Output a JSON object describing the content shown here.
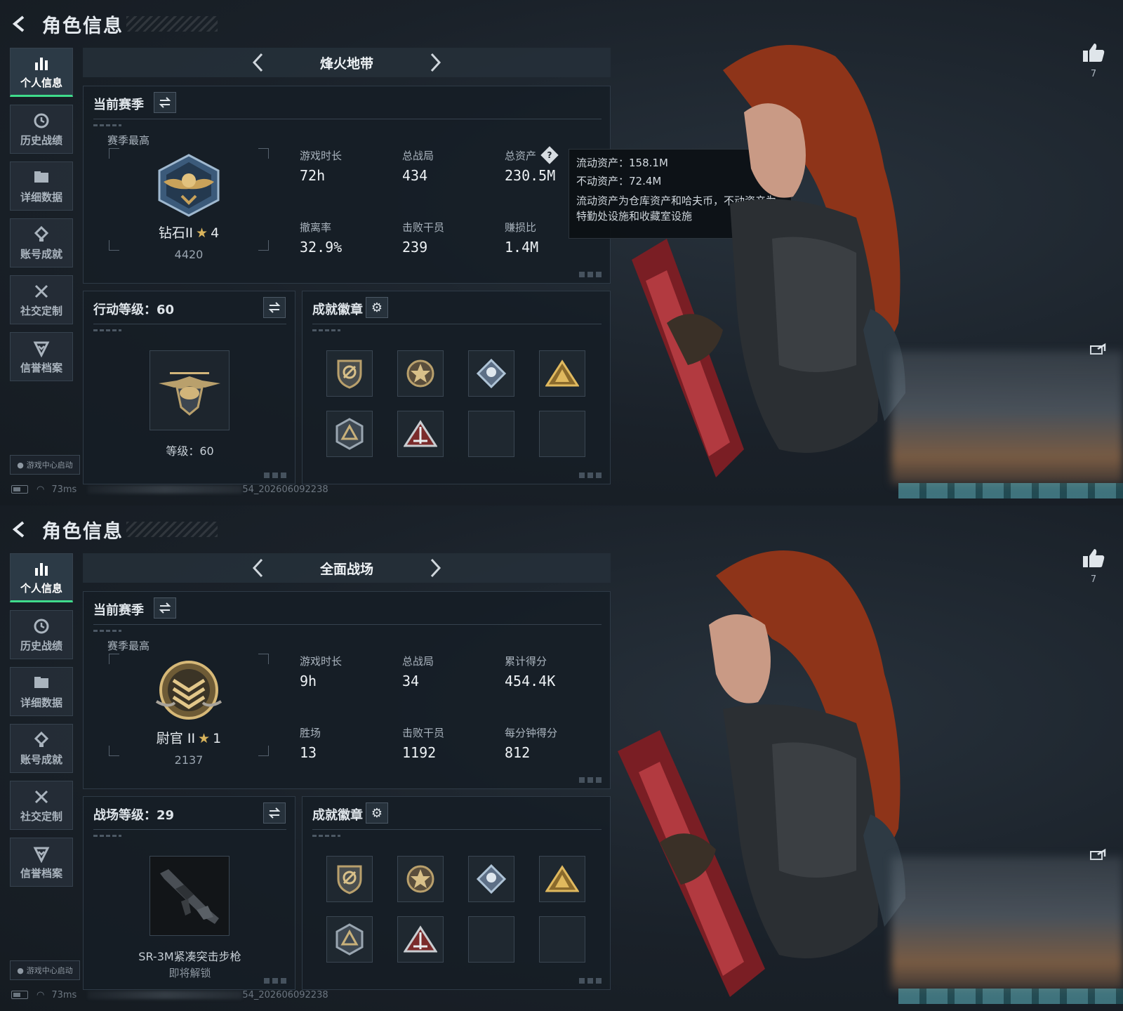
{
  "screens": [
    {
      "header": {
        "title": "角色信息"
      },
      "nav": {
        "items": [
          {
            "label": "个人信息",
            "icon": "bar-chart-icon",
            "active": true
          },
          {
            "label": "历史战绩",
            "icon": "clock-history-icon"
          },
          {
            "label": "详细数据",
            "icon": "folder-icon"
          },
          {
            "label": "账号成就",
            "icon": "achievement-icon"
          },
          {
            "label": "社交定制",
            "icon": "tools-icon"
          },
          {
            "label": "信誉档案",
            "icon": "shield-check-icon"
          }
        ]
      },
      "launcher": "游戏中心启动",
      "status": {
        "ping": "73ms",
        "build": "54_202606092238"
      },
      "mode": {
        "name": "烽火地带"
      },
      "season": {
        "title": "当前赛季",
        "best_label": "赛季最高",
        "rank_name": "钻石II",
        "rank_stars": "4",
        "rank_score": "4420",
        "stats": [
          {
            "label": "游戏时长",
            "value": "72h"
          },
          {
            "label": "总战局",
            "value": "434"
          },
          {
            "label": "总资产",
            "value": "230.5M",
            "help": true
          },
          {
            "label": "撤离率",
            "value": "32.9%"
          },
          {
            "label": "击败干员",
            "value": "239"
          },
          {
            "label": "赚损比",
            "value": "1.4M"
          }
        ]
      },
      "tooltip": {
        "line1": "流动资产：158.1M",
        "line2": "不动资产：72.4M",
        "desc": "流动资产为仓库资产和哈夫币，不动资产为特勤处设施和收藏室设施"
      },
      "level": {
        "title": "行动等级：60",
        "caption": "等级：60",
        "sub": ""
      },
      "badges": {
        "title": "成就徽章",
        "items": [
          "shield-badge",
          "star-badge",
          "diamond-badge",
          "mountain-badge",
          "triangle-shield-badge",
          "pyramid-badge",
          "empty",
          "empty"
        ]
      },
      "like": {
        "count": "7"
      },
      "colors": {
        "accent": "#3fdc8b",
        "star": "#d9b45c"
      }
    },
    {
      "header": {
        "title": "角色信息"
      },
      "nav": {
        "items": [
          {
            "label": "个人信息",
            "icon": "bar-chart-icon",
            "active": true
          },
          {
            "label": "历史战绩",
            "icon": "clock-history-icon"
          },
          {
            "label": "详细数据",
            "icon": "folder-icon"
          },
          {
            "label": "账号成就",
            "icon": "achievement-icon"
          },
          {
            "label": "社交定制",
            "icon": "tools-icon"
          },
          {
            "label": "信誉档案",
            "icon": "shield-check-icon"
          }
        ]
      },
      "launcher": "游戏中心启动",
      "status": {
        "ping": "73ms",
        "build": "54_202606092238"
      },
      "mode": {
        "name": "全面战场"
      },
      "season": {
        "title": "当前赛季",
        "best_label": "赛季最高",
        "rank_name": "尉官 II",
        "rank_stars": "1",
        "rank_score": "2137",
        "stats": [
          {
            "label": "游戏时长",
            "value": "9h"
          },
          {
            "label": "总战局",
            "value": "34"
          },
          {
            "label": "累计得分",
            "value": "454.4K"
          },
          {
            "label": "胜场",
            "value": "13"
          },
          {
            "label": "击败干员",
            "value": "1192"
          },
          {
            "label": "每分钟得分",
            "value": "812"
          }
        ]
      },
      "level": {
        "title": "战场等级：29",
        "caption": "SR-3M紧凑突击步枪",
        "sub": "即将解锁"
      },
      "badges": {
        "title": "成就徽章",
        "items": [
          "shield-badge",
          "star-badge",
          "diamond-badge",
          "mountain-badge",
          "triangle-shield-badge",
          "pyramid-badge",
          "empty",
          "empty"
        ]
      },
      "like": {
        "count": "7"
      },
      "colors": {
        "accent": "#3fdc8b",
        "star": "#d9b45c"
      }
    }
  ]
}
